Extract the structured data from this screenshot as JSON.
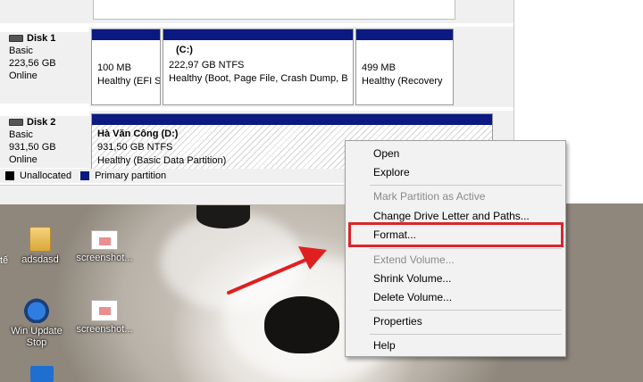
{
  "disks": [
    {
      "name": "Disk 1",
      "type": "Basic",
      "size": "223,56 GB",
      "status": "Online",
      "partitions": [
        {
          "label": "",
          "size": "100 MB",
          "status": "Healthy (EFI S"
        },
        {
          "label": "(C:)",
          "size": "222,97 GB NTFS",
          "status": "Healthy (Boot, Page File, Crash Dump, B"
        },
        {
          "label": "",
          "size": "499 MB",
          "status": "Healthy (Recovery"
        }
      ]
    },
    {
      "name": "Disk 2",
      "type": "Basic",
      "size": "931,50 GB",
      "status": "Online",
      "partitions": [
        {
          "label": "Hà Văn Công  (D:)",
          "size": "931,50 GB NTFS",
          "status": "Healthy (Basic Data Partition)"
        }
      ]
    }
  ],
  "legend": [
    {
      "label": "Unallocated",
      "color": "#000000"
    },
    {
      "label": "Primary partition",
      "color": "#0a1a80"
    }
  ],
  "context_menu": {
    "items": [
      {
        "label": "Open",
        "enabled": true
      },
      {
        "label": "Explore",
        "enabled": true
      },
      {
        "label": "Mark Partition as Active",
        "enabled": false
      },
      {
        "label": "Change Drive Letter and Paths...",
        "enabled": true
      },
      {
        "label": "Format...",
        "enabled": true,
        "highlighted": true
      },
      {
        "label": "Extend Volume...",
        "enabled": false
      },
      {
        "label": "Shrink Volume...",
        "enabled": true
      },
      {
        "label": "Delete Volume...",
        "enabled": true
      },
      {
        "label": "Properties",
        "enabled": true
      },
      {
        "label": "Help",
        "enabled": true
      }
    ]
  },
  "desktop_icons": [
    {
      "label": "adsdasd",
      "icon": "folder-icon"
    },
    {
      "label": "screenshot...",
      "icon": "document-icon"
    },
    {
      "label": "Win Update Stop",
      "icon": "shield-icon"
    },
    {
      "label": "screenshot...",
      "icon": "document-icon"
    },
    {
      "label": "tế",
      "icon": "text-fragment"
    }
  ],
  "annotation": {
    "highlight_color": "#d9262b",
    "arrow_color": "#e02020"
  }
}
